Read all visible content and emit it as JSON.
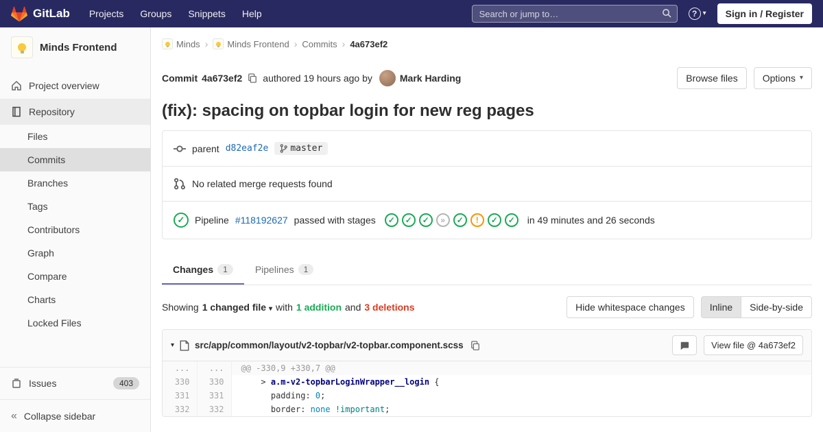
{
  "icons": {
    "caret_down": "▾",
    "breadcrumb_sep": "›",
    "collapse": "«",
    "check": "✓",
    "skipped": "»",
    "warning": "!"
  },
  "navbar": {
    "brand": "GitLab",
    "items": [
      "Projects",
      "Groups",
      "Snippets",
      "Help"
    ],
    "search_placeholder": "Search or jump to…",
    "help_glyph": "?",
    "sign_in": "Sign in / Register"
  },
  "sidebar": {
    "project_name": "Minds Frontend",
    "overview_label": "Project overview",
    "repository_label": "Repository",
    "repo_items": [
      {
        "label": "Files"
      },
      {
        "label": "Commits",
        "active": true
      },
      {
        "label": "Branches"
      },
      {
        "label": "Tags"
      },
      {
        "label": "Contributors"
      },
      {
        "label": "Graph"
      },
      {
        "label": "Compare"
      },
      {
        "label": "Charts"
      },
      {
        "label": "Locked Files"
      }
    ],
    "issues_label": "Issues",
    "issues_count": "403",
    "collapse_label": "Collapse sidebar"
  },
  "breadcrumb": {
    "items": [
      "Minds",
      "Minds Frontend",
      "Commits",
      "4a673ef2"
    ]
  },
  "commit": {
    "label": "Commit",
    "sha": "4a673ef2",
    "authored": "authored 19 hours ago by",
    "author": "Mark Harding",
    "browse_files": "Browse files",
    "options": "Options",
    "title": "(fix): spacing on topbar login for new reg pages",
    "parent_label": "parent",
    "parent_sha": "d82eaf2e",
    "branch": "master",
    "no_mr": "No related merge requests found",
    "pipeline_label": "Pipeline",
    "pipeline_id": "#118192627",
    "pipeline_status": "passed with stages",
    "pipeline_duration": "in 49 minutes and 26 seconds",
    "stages": [
      "passed",
      "passed",
      "passed",
      "skipped",
      "passed",
      "warning",
      "passed",
      "passed"
    ]
  },
  "tabs": [
    {
      "label": "Changes",
      "count": "1"
    },
    {
      "label": "Pipelines",
      "count": "1"
    }
  ],
  "diff_summary": {
    "showing": "Showing",
    "changed_file": "1 changed file",
    "with": "with",
    "additions": "1 addition",
    "and": "and",
    "deletions": "3 deletions",
    "hide_whitespace": "Hide whitespace changes",
    "inline": "Inline",
    "side_by_side": "Side-by-side"
  },
  "file": {
    "path": "src/app/common/layout/v2-topbar/v2-topbar.component.scss",
    "view_file": "View file @ 4a673ef2"
  },
  "diff": {
    "hunk_gutter": "...",
    "hunk_text": "@@ -330,9 +330,7 @@",
    "lines": [
      {
        "old": "330",
        "new": "330",
        "segments": [
          {
            "t": "    > ",
            "c": "pl"
          },
          {
            "t": "a.m-v2-topbarLoginWrapper__login",
            "c": "sel"
          },
          {
            "t": " {",
            "c": "pl"
          }
        ]
      },
      {
        "old": "331",
        "new": "331",
        "segments": [
          {
            "t": "      ",
            "c": "pl"
          },
          {
            "t": "padding",
            "c": "pl"
          },
          {
            "t": ": ",
            "c": "pl"
          },
          {
            "t": "0",
            "c": "num"
          },
          {
            "t": ";",
            "c": "pl"
          }
        ]
      },
      {
        "old": "332",
        "new": "332",
        "segments": [
          {
            "t": "      ",
            "c": "pl"
          },
          {
            "t": "border",
            "c": "pl"
          },
          {
            "t": ": ",
            "c": "pl"
          },
          {
            "t": "none",
            "c": "kw"
          },
          {
            "t": " ",
            "c": "pl"
          },
          {
            "t": "!important",
            "c": "imp"
          },
          {
            "t": ";",
            "c": "pl"
          }
        ]
      }
    ]
  }
}
